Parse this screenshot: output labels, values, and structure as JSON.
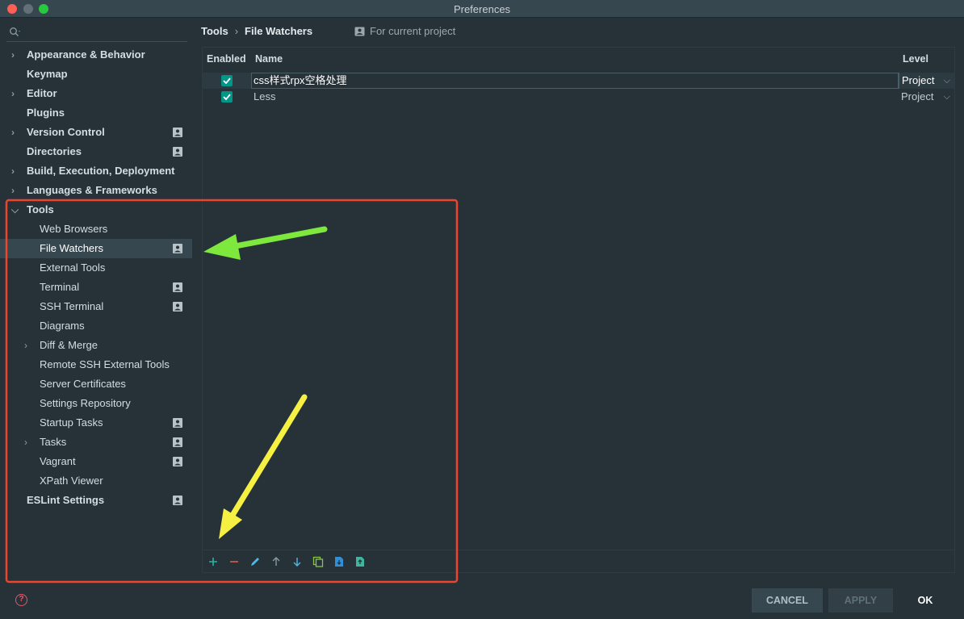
{
  "window": {
    "title": "Preferences"
  },
  "sidebar": {
    "items": [
      {
        "label": "Appearance & Behavior",
        "level": 0,
        "expandable": true,
        "expanded": false,
        "project": false,
        "selected": false
      },
      {
        "label": "Keymap",
        "level": 0,
        "expandable": false,
        "project": false,
        "selected": false
      },
      {
        "label": "Editor",
        "level": 0,
        "expandable": true,
        "expanded": false,
        "project": false,
        "selected": false
      },
      {
        "label": "Plugins",
        "level": 0,
        "expandable": false,
        "project": false,
        "selected": false
      },
      {
        "label": "Version Control",
        "level": 0,
        "expandable": true,
        "expanded": false,
        "project": true,
        "selected": false
      },
      {
        "label": "Directories",
        "level": 0,
        "expandable": false,
        "project": true,
        "selected": false
      },
      {
        "label": "Build, Execution, Deployment",
        "level": 0,
        "expandable": true,
        "expanded": false,
        "project": false,
        "selected": false
      },
      {
        "label": "Languages & Frameworks",
        "level": 0,
        "expandable": true,
        "expanded": false,
        "project": false,
        "selected": false
      },
      {
        "label": "Tools",
        "level": 0,
        "expandable": true,
        "expanded": true,
        "project": false,
        "selected": false
      },
      {
        "label": "Web Browsers",
        "level": 1,
        "expandable": false,
        "project": false,
        "selected": false
      },
      {
        "label": "File Watchers",
        "level": 1,
        "expandable": false,
        "project": true,
        "selected": true
      },
      {
        "label": "External Tools",
        "level": 1,
        "expandable": false,
        "project": false,
        "selected": false
      },
      {
        "label": "Terminal",
        "level": 1,
        "expandable": false,
        "project": true,
        "selected": false
      },
      {
        "label": "SSH Terminal",
        "level": 1,
        "expandable": false,
        "project": true,
        "selected": false
      },
      {
        "label": "Diagrams",
        "level": 1,
        "expandable": false,
        "project": false,
        "selected": false
      },
      {
        "label": "Diff & Merge",
        "level": 1,
        "expandable": true,
        "expanded": false,
        "project": false,
        "selected": false
      },
      {
        "label": "Remote SSH External Tools",
        "level": 1,
        "expandable": false,
        "project": false,
        "selected": false
      },
      {
        "label": "Server Certificates",
        "level": 1,
        "expandable": false,
        "project": false,
        "selected": false
      },
      {
        "label": "Settings Repository",
        "level": 1,
        "expandable": false,
        "project": false,
        "selected": false
      },
      {
        "label": "Startup Tasks",
        "level": 1,
        "expandable": false,
        "project": true,
        "selected": false
      },
      {
        "label": "Tasks",
        "level": 1,
        "expandable": true,
        "expanded": false,
        "project": true,
        "selected": false
      },
      {
        "label": "Vagrant",
        "level": 1,
        "expandable": false,
        "project": true,
        "selected": false
      },
      {
        "label": "XPath Viewer",
        "level": 1,
        "expandable": false,
        "project": false,
        "selected": false
      },
      {
        "label": "ESLint Settings",
        "level": 0,
        "expandable": false,
        "project": true,
        "selected": false
      }
    ]
  },
  "breadcrumb": {
    "parent": "Tools",
    "separator": "›",
    "current": "File Watchers"
  },
  "scope": {
    "label": "For current project"
  },
  "table": {
    "headers": {
      "enabled": "Enabled",
      "name": "Name",
      "level": "Level"
    },
    "rows": [
      {
        "enabled": true,
        "name": "css样式rpx空格处理",
        "level": "Project"
      },
      {
        "enabled": true,
        "name": "Less",
        "level": "Project"
      }
    ]
  },
  "toolbar": {
    "buttons": [
      "add-icon",
      "remove-icon",
      "edit-icon",
      "move-up-icon",
      "move-down-icon",
      "copy-icon",
      "import-icon",
      "export-icon"
    ]
  },
  "footer": {
    "help": "?",
    "cancel": "CANCEL",
    "apply": "APPLY",
    "ok": "OK"
  },
  "colors": {
    "accent": "#009688",
    "annotation_red": "#f0432e",
    "annotation_green": "#7ee83c",
    "annotation_yellow": "#f6f043"
  }
}
